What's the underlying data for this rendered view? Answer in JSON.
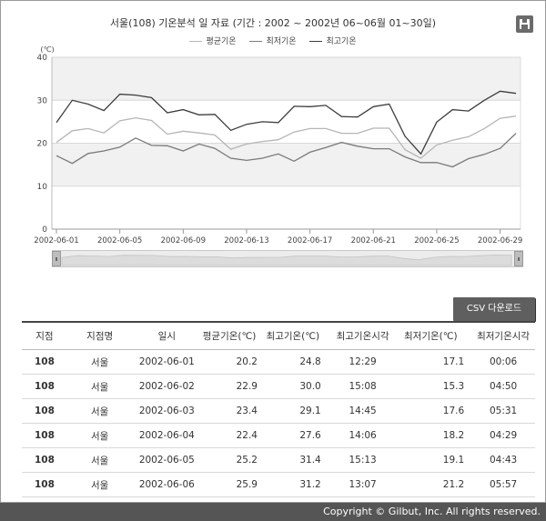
{
  "chart": {
    "title": "서울(108) 기온분석 일 자료 (기간 : 2002 ~ 2002년  06~06월 01~30일)",
    "legend": [
      "평균기온",
      "최저기온",
      "최고기온"
    ],
    "unit_label": "(℃)",
    "save_icon": "floppy-disk-icon"
  },
  "chart_data": {
    "type": "line",
    "title": "서울(108) 기온분석 일 자료 (기간 : 2002 ~ 2002년  06~06월 01~30일)",
    "ylabel": "(℃)",
    "ylim": [
      0,
      40
    ],
    "yticks": [
      0,
      10,
      20,
      30,
      40
    ],
    "bands": [
      [
        10,
        20
      ],
      [
        30,
        40
      ]
    ],
    "x": [
      "2002-06-01",
      "2002-06-02",
      "2002-06-03",
      "2002-06-04",
      "2002-06-05",
      "2002-06-06",
      "2002-06-07",
      "2002-06-08",
      "2002-06-09",
      "2002-06-10",
      "2002-06-11",
      "2002-06-12",
      "2002-06-13",
      "2002-06-14",
      "2002-06-15",
      "2002-06-16",
      "2002-06-17",
      "2002-06-18",
      "2002-06-19",
      "2002-06-20",
      "2002-06-21",
      "2002-06-22",
      "2002-06-23",
      "2002-06-24",
      "2002-06-25",
      "2002-06-26",
      "2002-06-27",
      "2002-06-28",
      "2002-06-29",
      "2002-06-30"
    ],
    "xtick_labels": [
      "2002-06-01",
      "2002-06-05",
      "2002-06-09",
      "2002-06-13",
      "2002-06-17",
      "2002-06-21",
      "2002-06-25",
      "2002-06-29"
    ],
    "series": [
      {
        "name": "평균기온",
        "color": "#b5b5b5",
        "values": [
          20.2,
          22.9,
          23.4,
          22.4,
          25.2,
          25.9,
          25.3,
          22.1,
          22.8,
          22.4,
          21.9,
          18.6,
          19.8,
          20.4,
          20.8,
          22.6,
          23.4,
          23.4,
          22.3,
          22.3,
          23.5,
          23.5,
          18.5,
          16.5,
          19.6,
          20.7,
          21.5,
          23.4,
          25.8,
          26.3
        ]
      },
      {
        "name": "최저기온",
        "color": "#7a7a7a",
        "values": [
          17.1,
          15.3,
          17.6,
          18.2,
          19.1,
          21.2,
          19.5,
          19.4,
          18.2,
          19.8,
          18.8,
          16.5,
          16.0,
          16.5,
          17.5,
          15.8,
          17.9,
          19.0,
          20.2,
          19.3,
          18.7,
          18.7,
          16.8,
          15.5,
          15.5,
          14.5,
          16.4,
          17.4,
          18.8,
          22.3
        ]
      },
      {
        "name": "최고기온",
        "color": "#3d3d3d",
        "values": [
          24.8,
          30.0,
          29.1,
          27.6,
          31.4,
          31.2,
          30.6,
          27.1,
          27.8,
          26.6,
          26.7,
          23.0,
          24.4,
          25.0,
          24.8,
          28.6,
          28.5,
          28.8,
          26.2,
          26.1,
          28.5,
          29.1,
          21.6,
          17.5,
          24.9,
          27.8,
          27.5,
          30.0,
          32.1,
          31.6
        ]
      }
    ]
  },
  "download": {
    "csv_label": "CSV 다운로드"
  },
  "table": {
    "headers": [
      "지점",
      "지점명",
      "일시",
      "평균기온(℃)",
      "최고기온(℃)",
      "최고기온시각",
      "최저기온(℃)",
      "최저기온시각"
    ],
    "rows": [
      [
        "108",
        "서울",
        "2002-06-01",
        "20.2",
        "24.8",
        "12:29",
        "17.1",
        "00:06"
      ],
      [
        "108",
        "서울",
        "2002-06-02",
        "22.9",
        "30.0",
        "15:08",
        "15.3",
        "04:50"
      ],
      [
        "108",
        "서울",
        "2002-06-03",
        "23.4",
        "29.1",
        "14:45",
        "17.6",
        "05:31"
      ],
      [
        "108",
        "서울",
        "2002-06-04",
        "22.4",
        "27.6",
        "14:06",
        "18.2",
        "04:29"
      ],
      [
        "108",
        "서울",
        "2002-06-05",
        "25.2",
        "31.4",
        "15:13",
        "19.1",
        "04:43"
      ],
      [
        "108",
        "서울",
        "2002-06-06",
        "25.9",
        "31.2",
        "13:07",
        "21.2",
        "05:57"
      ]
    ]
  },
  "footer": {
    "copyright": "Copyright © Gilbut, Inc. All rights reserved."
  }
}
